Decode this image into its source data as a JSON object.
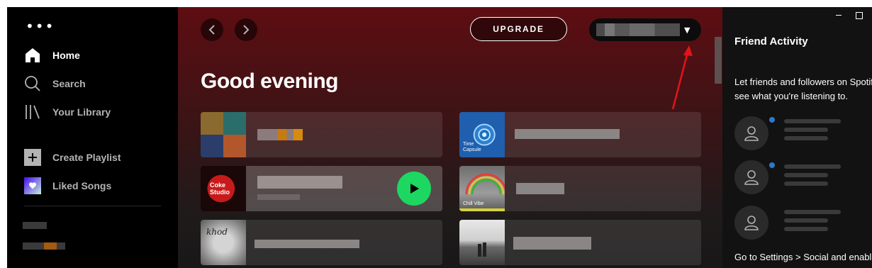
{
  "sidebar": {
    "menu_dots": "•••",
    "nav": [
      {
        "label": "Home",
        "icon": "home-icon",
        "active": true
      },
      {
        "label": "Search",
        "icon": "search-icon",
        "active": false
      },
      {
        "label": "Your Library",
        "icon": "library-icon",
        "active": false
      }
    ],
    "actions": [
      {
        "label": "Create Playlist",
        "icon": "plus-icon"
      },
      {
        "label": "Liked Songs",
        "icon": "heart-icon"
      }
    ]
  },
  "header": {
    "upgrade_label": "UPGRADE",
    "user_caret": "▼"
  },
  "main": {
    "greeting": "Good evening",
    "cards": [
      {
        "thumb_text": ""
      },
      {
        "thumb_text": "Time\nCapsule"
      },
      {
        "thumb_text": "Coke\nStudio"
      },
      {
        "thumb_text": "Chill Vibe"
      },
      {
        "thumb_text": "khod"
      },
      {
        "thumb_text": ""
      }
    ]
  },
  "friend_activity": {
    "title": "Friend Activity",
    "description": "Let friends and followers on Spotify see what you're listening to.",
    "footer": "Go to Settings > Social and enable"
  },
  "colors": {
    "accent_green": "#1ed760",
    "header_red": "#5e0d12",
    "annotation_red": "#e0151b",
    "online_dot": "#2e77d0"
  }
}
